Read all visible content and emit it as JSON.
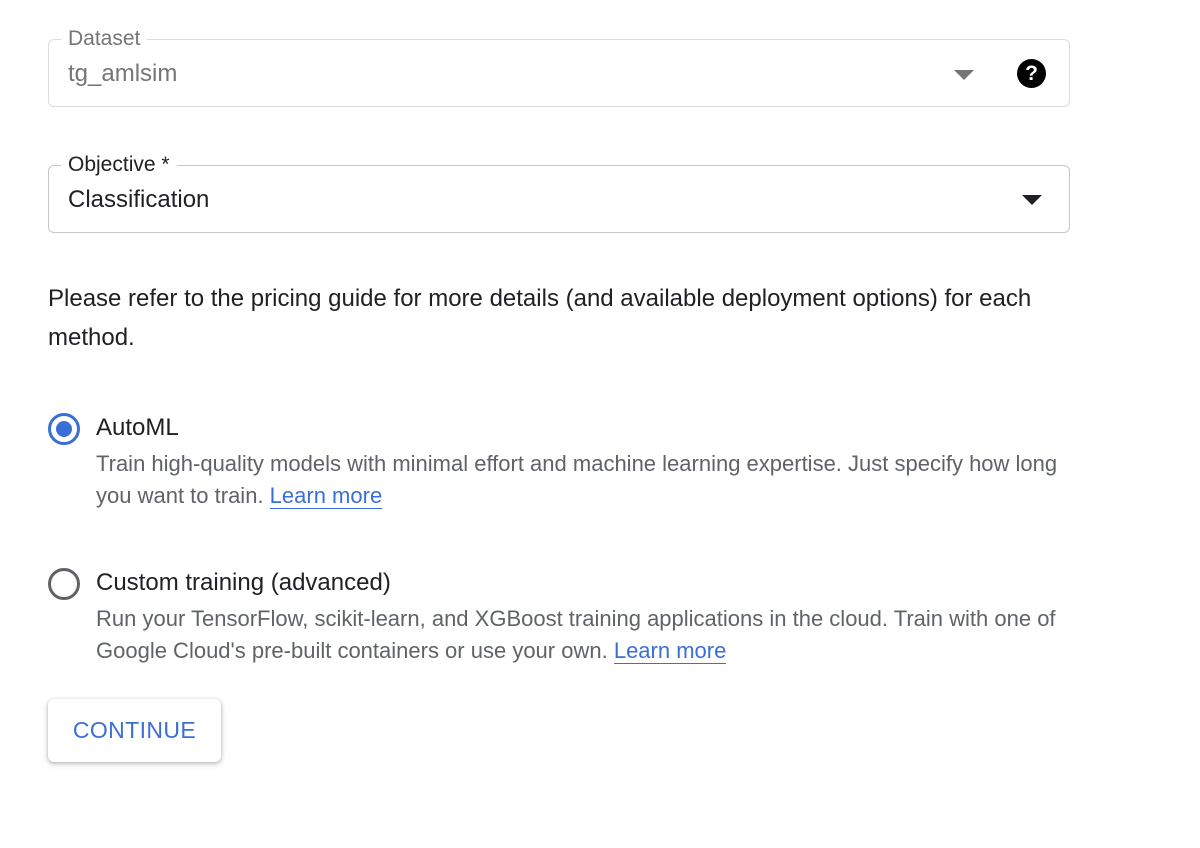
{
  "dataset_field": {
    "label": "Dataset",
    "value": "tg_amlsim",
    "help_icon": "?",
    "arrow_icon": "arrow-drop-down-icon"
  },
  "objective_field": {
    "label": "Objective *",
    "value": "Classification",
    "arrow_icon": "arrow-drop-down-icon"
  },
  "info_text": "Please refer to the pricing guide for more details (and available deployment options) for each method.",
  "training_options": [
    {
      "title": "AutoML",
      "description": "Train high-quality models with minimal effort and machine learning expertise. Just specify how long you want to train.",
      "link_label": "Learn more",
      "selected": true
    },
    {
      "title": "Custom training (advanced)",
      "description": "Run your TensorFlow, scikit-learn, and XGBoost training applications in the cloud. Train with one of Google Cloud's pre-built containers or use your own.",
      "link_label": "Learn more",
      "selected": false
    }
  ],
  "continue_button": {
    "label": "CONTINUE"
  },
  "colors": {
    "accent": "#3b6fd8",
    "text_primary": "#202124",
    "text_secondary": "#5f6368",
    "text_disabled": "#757575",
    "border": "#dadce0"
  }
}
